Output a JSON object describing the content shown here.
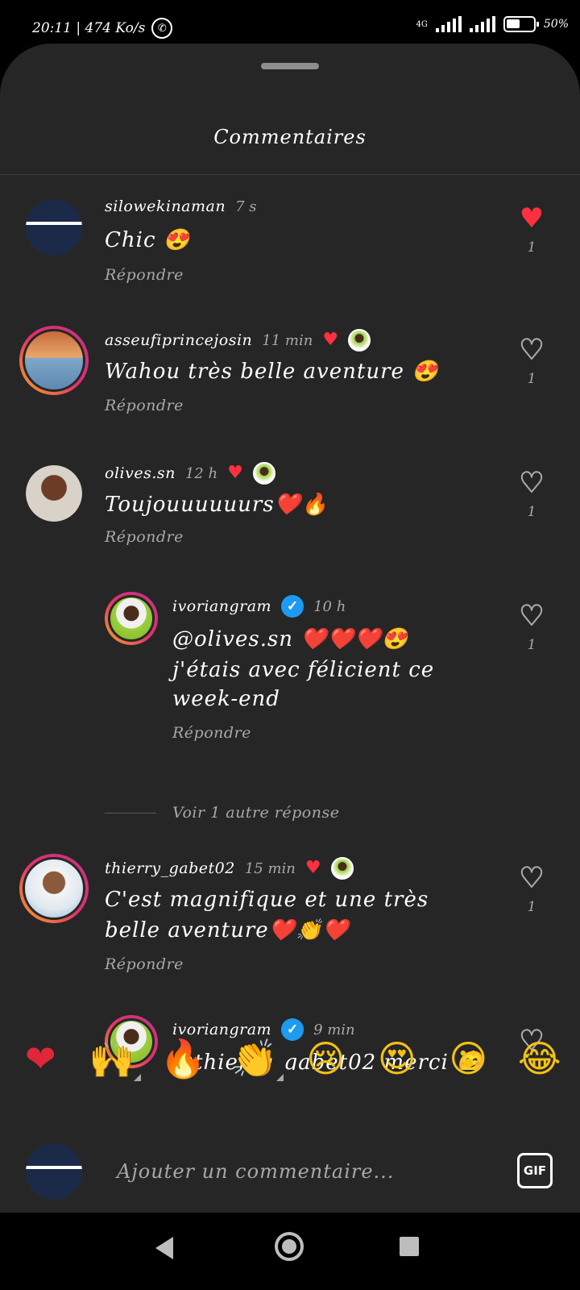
{
  "status_bar": {
    "time_speed": "20:11 | 474 Ko/s",
    "network": "4G",
    "battery": "50%",
    "whatsapp_icon": "whatsapp-icon"
  },
  "sheet": {
    "title": "Commentaires"
  },
  "comments": [
    {
      "username": "silowekinaman",
      "time": "7 s",
      "text": "Chic 😍",
      "reply_label": "Répondre",
      "likes": "1",
      "liked": true,
      "author_liked": false
    },
    {
      "username": "asseufiprincejosin",
      "time": "11 min",
      "text": "Wahou très belle aventure 😍",
      "reply_label": "Répondre",
      "likes": "1",
      "liked": false,
      "author_liked": true
    },
    {
      "username": "olives.sn",
      "time": "12 h",
      "text": "Toujouuuuuurs❤️🔥",
      "reply_label": "Répondre",
      "likes": "1",
      "liked": false,
      "author_liked": true
    },
    {
      "username": "ivoriangram",
      "time": "10 h",
      "verified": true,
      "text_line1": "@olives.sn ❤️❤️❤️😍",
      "text_line2": "j'étais avec félicient ce",
      "text_line3": "week-end",
      "reply_label": "Répondre",
      "likes": "1",
      "liked": false
    },
    {
      "username": "thierry_gabet02",
      "time": "15 min",
      "text_line1": "C'est magnifique et une très",
      "text_line2": "belle aventure❤️👏❤️",
      "reply_label": "Répondre",
      "likes": "1",
      "liked": false,
      "author_liked": true
    },
    {
      "username": "ivoriangram",
      "time": "9 min",
      "verified": true,
      "text": "@thierry_gabet02 merci 😊",
      "liked": false
    }
  ],
  "view_more": "Voir 1 autre réponse",
  "quick_reactions": [
    "❤",
    "🙌",
    "🔥",
    "👏",
    "😢",
    "😍",
    "😮",
    "😂"
  ],
  "composer": {
    "placeholder": "Ajouter un commentaire...",
    "gif_label": "GIF"
  },
  "colors": {
    "background": "#262626",
    "like_red": "#ff3040",
    "secondary_text": "#a8a8a8",
    "verified_blue": "#1d9bf0"
  }
}
